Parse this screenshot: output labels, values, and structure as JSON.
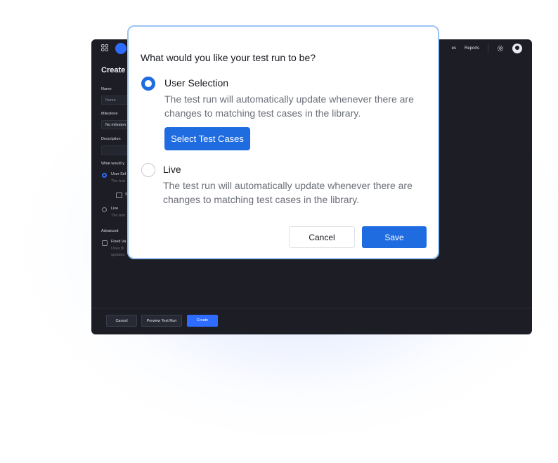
{
  "colors": {
    "accent": "#1f6ce0",
    "app_bg": "#1c1d25",
    "dialog_border": "#9cc4f4"
  },
  "app": {
    "nav": {
      "item_partial": "es",
      "reports": "Reports"
    },
    "page_title": "Create",
    "form": {
      "name_label": "Name",
      "name_placeholder": "Name",
      "milestone_label": "Milestone",
      "milestone_value": "No mileston",
      "description_label": "Description",
      "question_partial": "What would y",
      "user_sel_partial": "User Sel",
      "user_sel_desc_partial": "The test",
      "select_mini_partial": "S",
      "live_label": "Live",
      "live_desc_partial": "The test",
      "advanced_label": "Advanced",
      "fixed_label_partial": "Fixed Va",
      "fixed_desc_partial_1": "Uses th",
      "fixed_desc_partial_2": "updates"
    },
    "footer": {
      "cancel": "Cancel",
      "preview": "Preview Test Run",
      "create": "Create"
    }
  },
  "dialog": {
    "question": "What would you like your test run to be?",
    "options": [
      {
        "label": "User Selection",
        "selected": true,
        "description": "The test run will automatically update whenever there are changes to matching test cases in the library.",
        "action_label": "Select Test Cases"
      },
      {
        "label": "Live",
        "selected": false,
        "description": "The test run will automatically update whenever there are changes to matching test cases in the library."
      }
    ],
    "cancel_label": "Cancel",
    "save_label": "Save"
  }
}
